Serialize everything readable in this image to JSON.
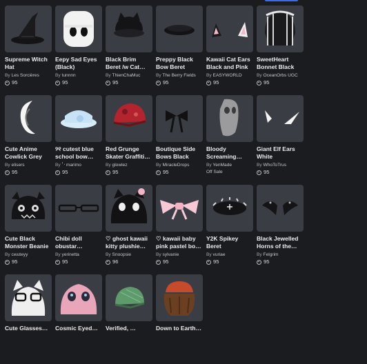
{
  "items": [
    {
      "name": "Supreme Witch Hat",
      "creator": "Les Sorcières",
      "price": "95",
      "icon": "witch-hat-icon"
    },
    {
      "name": "Eepy Sad Eyes (Black)",
      "creator": "tunnnn",
      "price": "95",
      "icon": "sad-eyes-face-icon"
    },
    {
      "name": "Black Brim Beret /w Cat…",
      "creator": "ThienChaMuc",
      "price": "95",
      "icon": "cat-beret-icon"
    },
    {
      "name": "Preppy Black Bow Beret",
      "creator": "The Berry Fields",
      "price": "95",
      "icon": "bow-beret-icon"
    },
    {
      "name": "Kawaii Cat Ears Black and Pink",
      "creator": "EASYWORLD",
      "price": "95",
      "icon": "cat-ears-icon"
    },
    {
      "name": "SweetHeart Bonnet Black",
      "creator": "OceanOrbs UGC",
      "price": "95",
      "icon": "bonnet-icon"
    },
    {
      "name": "Cute Anime Cowlick Grey",
      "creator": "elisers",
      "price": "95",
      "icon": "cowlick-icon"
    },
    {
      "name": "୨୧ cutest blue school bow…",
      "creator": "ꜝ᠂ marimo",
      "price": "95",
      "icon": "blue-bow-icon"
    },
    {
      "name": "Red Grunge Skater Graffiti…",
      "creator": "glowlez",
      "price": "95",
      "icon": "red-cap-icon"
    },
    {
      "name": "Boutique Side Bows Black",
      "creator": "MiracleDrops",
      "price": "95",
      "icon": "side-bows-icon"
    },
    {
      "name": "Bloody Screaming…",
      "creator": "YenMade",
      "price": "",
      "status": "Off Sale",
      "icon": "scream-mask-icon"
    },
    {
      "name": "Giant Elf Ears White",
      "creator": "WhoToTrus",
      "price": "95",
      "icon": "elf-ears-icon"
    },
    {
      "name": "Cute Black Monster Beanie",
      "creator": "cwuteyy",
      "price": "95",
      "icon": "monster-beanie-icon"
    },
    {
      "name": "Chibi doll obustar glasse…",
      "creator": "yerinetta",
      "price": "95",
      "icon": "glasses-icon"
    },
    {
      "name": "♡ ghost kawaii kitty plushie…",
      "creator": "Snoopsie",
      "price": "96",
      "icon": "kitty-plush-hat-icon"
    },
    {
      "name": "♡ kawaii baby pink pastel bo…",
      "creator": "sylvanie",
      "price": "95",
      "icon": "pink-bow-icon"
    },
    {
      "name": "Y2K Spikey Beret",
      "creator": "vuriae",
      "price": "95",
      "icon": "spikey-beret-icon"
    },
    {
      "name": "Black Jewelled Horns of the…",
      "creator": "Felgrim",
      "price": "95",
      "icon": "jewelled-horns-icon"
    },
    {
      "name": "Cute Glasses…",
      "creator": "",
      "price": "",
      "icon": "cat-hood-glasses-icon"
    },
    {
      "name": "Cosmic Eyed…",
      "creator": "",
      "price": "",
      "icon": "pink-creature-hat-icon"
    },
    {
      "name": "Verified, …",
      "creator": "",
      "price": "",
      "icon": "green-cap-icon"
    },
    {
      "name": "Down to Earth…",
      "creator": "",
      "price": "",
      "icon": "brown-hair-beanie-icon"
    }
  ],
  "labels": {
    "by": "By"
  }
}
